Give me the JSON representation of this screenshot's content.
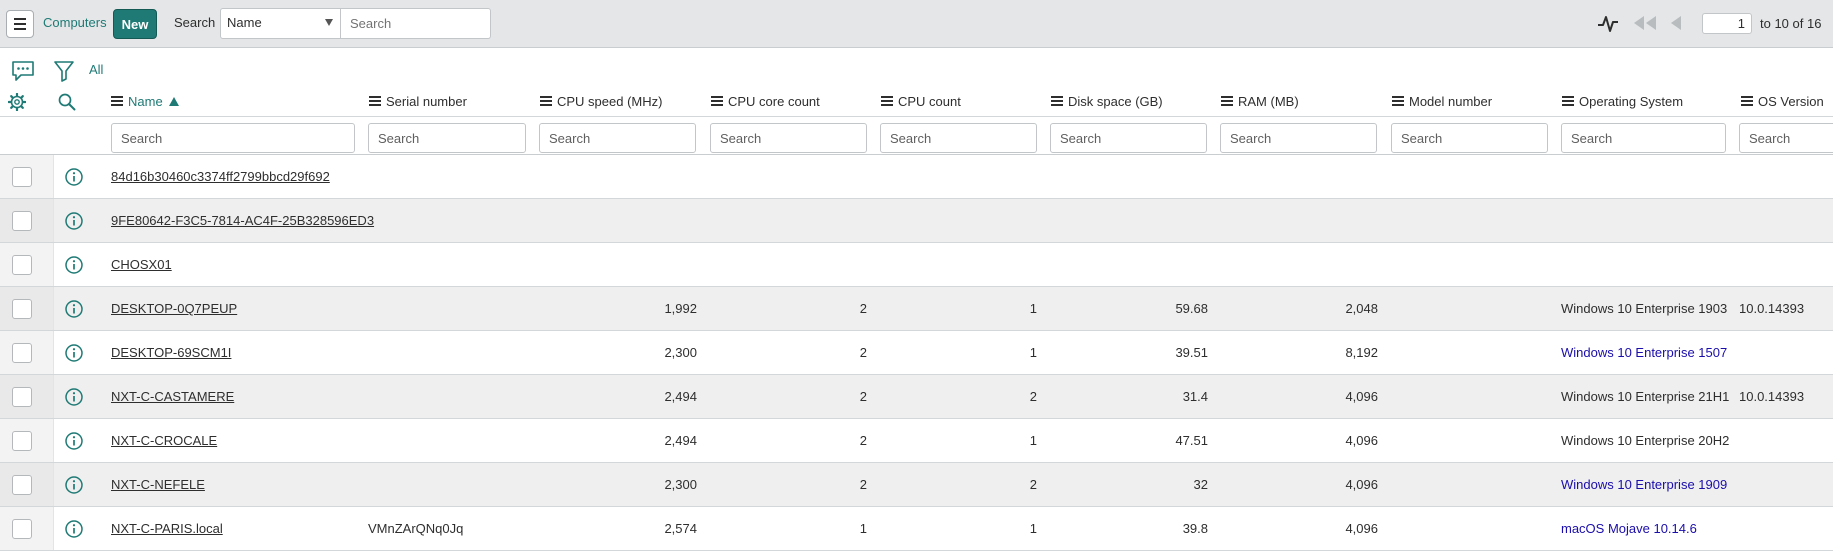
{
  "toolbar": {
    "list_title": "Computers",
    "new_label": "New",
    "search_label": "Search",
    "field_selected": "Name",
    "search_placeholder": "Search",
    "page_value": "1",
    "range_text": "to 10 of 16"
  },
  "filter": {
    "all_label": "All"
  },
  "columns": [
    {
      "label": "Name",
      "sorted": "ascending"
    },
    {
      "label": "Serial number"
    },
    {
      "label": "CPU speed (MHz)"
    },
    {
      "label": "CPU core count"
    },
    {
      "label": "CPU count"
    },
    {
      "label": "Disk space (GB)"
    },
    {
      "label": "RAM (MB)"
    },
    {
      "label": "Model number"
    },
    {
      "label": "Operating System"
    },
    {
      "label": "OS Version"
    }
  ],
  "column_filter_placeholder": "Search",
  "rows": [
    {
      "name": "84d16b30460c3374ff2799bbcd29f692",
      "serial": "",
      "cpu_speed": "",
      "cpu_cores": "",
      "cpu_count": "",
      "disk": "",
      "ram": "",
      "model": "",
      "os": "",
      "os_version": ""
    },
    {
      "name": "9FE80642-F3C5-7814-AC4F-25B328596ED3",
      "serial": "",
      "cpu_speed": "",
      "cpu_cores": "",
      "cpu_count": "",
      "disk": "",
      "ram": "",
      "model": "",
      "os": "",
      "os_version": ""
    },
    {
      "name": "CHOSX01",
      "serial": "",
      "cpu_speed": "",
      "cpu_cores": "",
      "cpu_count": "",
      "disk": "",
      "ram": "",
      "model": "",
      "os": "",
      "os_version": ""
    },
    {
      "name": "DESKTOP-0Q7PEUP",
      "serial": "",
      "cpu_speed": "1,992",
      "cpu_cores": "2",
      "cpu_count": "1",
      "disk": "59.68",
      "ram": "2,048",
      "model": "",
      "os": "Windows 10 Enterprise 1903",
      "os_version": "10.0.14393"
    },
    {
      "name": "DESKTOP-69SCM1I",
      "serial": "",
      "cpu_speed": "2,300",
      "cpu_cores": "2",
      "cpu_count": "1",
      "disk": "39.51",
      "ram": "8,192",
      "model": "",
      "os": "Windows 10 Enterprise 1507",
      "os_link": true,
      "os_version": ""
    },
    {
      "name": "NXT-C-CASTAMERE",
      "serial": "",
      "cpu_speed": "2,494",
      "cpu_cores": "2",
      "cpu_count": "2",
      "disk": "31.4",
      "ram": "4,096",
      "model": "",
      "os": "Windows 10 Enterprise 21H1",
      "os_version": "10.0.14393"
    },
    {
      "name": "NXT-C-CROCALE",
      "serial": "",
      "cpu_speed": "2,494",
      "cpu_cores": "2",
      "cpu_count": "1",
      "disk": "47.51",
      "ram": "4,096",
      "model": "",
      "os": "Windows 10 Enterprise 20H2",
      "os_version": ""
    },
    {
      "name": "NXT-C-NEFELE",
      "serial": "",
      "cpu_speed": "2,300",
      "cpu_cores": "2",
      "cpu_count": "2",
      "disk": "32",
      "ram": "4,096",
      "model": "",
      "os": "Windows 10 Enterprise 1909",
      "os_link": true,
      "os_version": ""
    },
    {
      "name": "NXT-C-PARIS.local",
      "serial": "VMnZArQNq0Jq",
      "cpu_speed": "2,574",
      "cpu_cores": "1",
      "cpu_count": "1",
      "disk": "39.8",
      "ram": "4,096",
      "model": "",
      "os": "macOS Mojave 10.14.6",
      "os_link": true,
      "os_version": ""
    }
  ],
  "colors": {
    "accent": "#1f7a75",
    "link_blue": "#1a0dab",
    "toolbar_bg": "#e4e6e7",
    "row_alt_bg": "#efefef"
  },
  "icons": [
    "menu-icon",
    "activity-icon",
    "first-page-icon",
    "previous-page-icon",
    "comment-icon",
    "filter-icon",
    "gear-icon",
    "search-icon",
    "info-icon",
    "sort-ascending-icon"
  ]
}
